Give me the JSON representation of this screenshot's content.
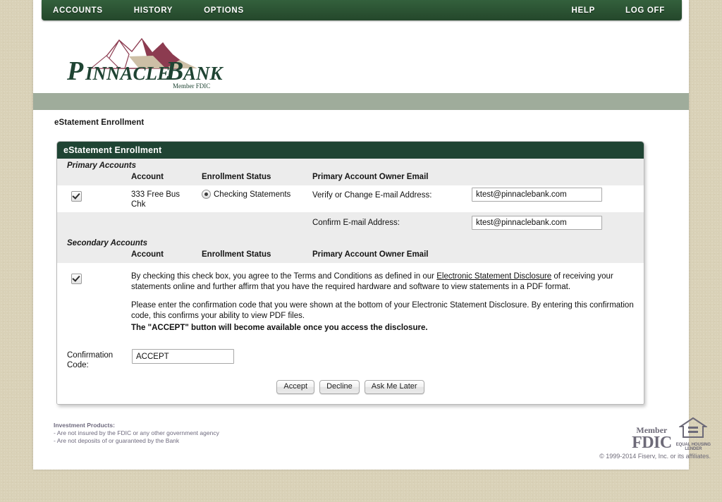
{
  "nav": {
    "left_items": [
      {
        "label": "ACCOUNTS",
        "name": "accounts"
      },
      {
        "label": "HISTORY",
        "name": "history"
      },
      {
        "label": "OPTIONS",
        "name": "options"
      }
    ],
    "right_items": [
      {
        "label": "HELP",
        "name": "help"
      },
      {
        "label": "LOG OFF",
        "name": "log-off"
      }
    ]
  },
  "brand": {
    "name": "PINNACLE BANK",
    "word_one": "P",
    "word_rest": "INNACLE",
    "word_two_first": "B",
    "word_two_rest": "ANK",
    "tagline": "Member FDIC",
    "colors": {
      "green": "#1f4433",
      "maroon": "#8c3b50",
      "tan": "#cdbfa6",
      "nav_green": "#2d5635",
      "sage": "#9fac9b"
    }
  },
  "breadcrumb": "eStatement Enrollment",
  "panel": {
    "title": "eStatement Enrollment",
    "primary": {
      "section_label": "Primary Accounts",
      "columns": {
        "account": "Account",
        "status": "Enrollment Status",
        "email": "Primary Account Owner Email"
      },
      "row": {
        "checkbox_checked": true,
        "account": "333 Free Bus Chk",
        "status_option": "Checking Statements",
        "status_selected": true,
        "verify_label": "Verify or Change E-mail Address:",
        "verify_value": "ktest@pinnaclebank.com",
        "confirm_label": "Confirm E-mail Address:",
        "confirm_value": "ktest@pinnaclebank.com"
      }
    },
    "secondary": {
      "section_label": "Secondary Accounts",
      "columns": {
        "account": "Account",
        "status": "Enrollment Status",
        "email": "Primary Account Owner Email"
      }
    },
    "terms": {
      "checkbox_checked": true,
      "para1_before": "By checking this check box, you agree to the Terms and Conditions as defined in our ",
      "link": "Electronic Statement Disclosure",
      "para1_after": " of receiving your statements online and further affirm that you have the required hardware and software to view statements in a PDF format.",
      "para2": "Please enter the confirmation code that you were shown at the bottom of your Electronic Statement Disclosure. By entering this confirmation code, this confirms your ability to view PDF files.",
      "para3_bold": "The \"ACCEPT\" button will become available once you access the disclosure."
    },
    "confirmation": {
      "label": "Confirmation Code:",
      "label_line1": "Confirmation",
      "label_line2": "Code:",
      "value": "ACCEPT"
    },
    "buttons": [
      {
        "label": "Accept",
        "name": "accept-button"
      },
      {
        "label": "Decline",
        "name": "decline-button"
      },
      {
        "label": "Ask Me Later",
        "name": "ask-me-later-button"
      }
    ]
  },
  "footer": {
    "disclosure_title": "Investment Products:",
    "disclosure_line1": "- Are not insured by the FDIC or any other government agency",
    "disclosure_line2": "- Are not deposits of or guaranteed by the Bank",
    "fdic_member": "Member",
    "fdic_name": "FDIC",
    "lender_line1": "EQUAL HOUSING",
    "lender_line2": "LENDER",
    "copyright": "© 1999-2014 Fiserv, Inc. or its affiliates."
  }
}
